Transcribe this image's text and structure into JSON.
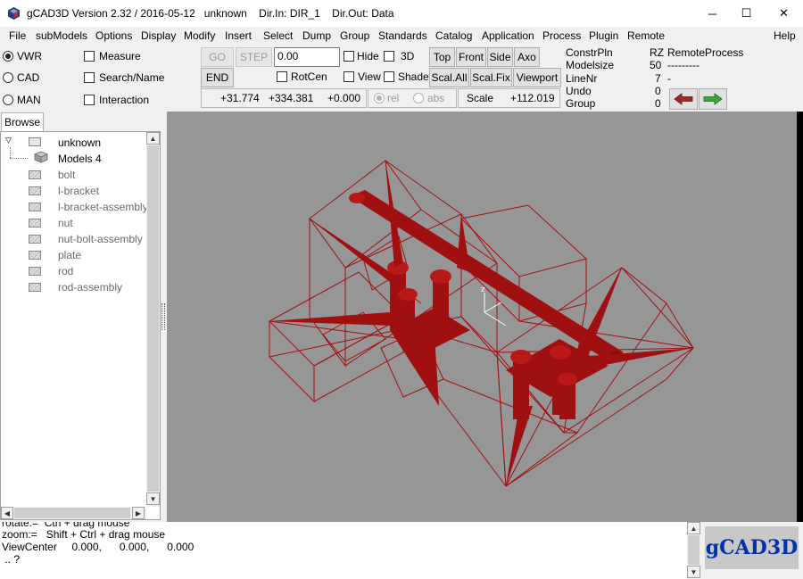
{
  "window": {
    "title": "gCAD3D Version 2.32 / 2016-05-12   unknown    Dir.In: DIR_1    Dir.Out: Data",
    "controls": {
      "minimize": "─",
      "maximize": "☐",
      "close": "✕"
    }
  },
  "menu": [
    "File",
    "subModels",
    "Options",
    "Display",
    "Modify",
    "Insert",
    "Select",
    "Dump",
    "Group",
    "Standards",
    "Catalog",
    "Application",
    "Process",
    "Plugin",
    "Remote",
    "Help"
  ],
  "modes": {
    "vwr": "VWR",
    "cad": "CAD",
    "man": "MAN",
    "selected": "VWR"
  },
  "options": {
    "measure": "Measure",
    "search": "Search/Name",
    "interaction": "Interaction"
  },
  "toolbar": {
    "go": "GO",
    "step": "STEP",
    "step_value": "0.00",
    "end": "END",
    "hide": "Hide",
    "three_d": "3D",
    "rotcen": "RotCen",
    "view": "View",
    "shade": "Shade",
    "top": "Top",
    "front": "Front",
    "side": "Side",
    "axo": "Axo",
    "scal_all": "Scal.All",
    "scal_fix": "Scal.Fix",
    "viewport": "Viewport"
  },
  "coords": {
    "x": "+31.774",
    "y": "+334.381",
    "z": "+0.000",
    "rel": "rel",
    "abs": "abs",
    "scale_label": "Scale",
    "scale_value": "+112.019"
  },
  "status": {
    "labels": [
      "ConstrPln",
      "Modelsize",
      "LineNr",
      "Undo",
      "Group"
    ],
    "values": [
      "RZ",
      "50",
      "7",
      "0",
      "0"
    ],
    "remote": "RemoteProcess",
    "remote_line": "---------",
    "remote_dash": "-"
  },
  "browse": {
    "tab": "Browse",
    "root": "unknown",
    "models_label": "Models 4",
    "items": [
      "bolt",
      "l-bracket",
      "l-bracket-assembly",
      "nut",
      "nut-bolt-assembly",
      "plate",
      "rod",
      "rod-assembly"
    ]
  },
  "console": {
    "lines": [
      "rotate:=  Ctrl + drag mouse",
      "zoom:=   Shift + Ctrl + drag mouse",
      "ViewCenter     0.000,      0.000,      0.000",
      " .. ?"
    ]
  },
  "logo": "gCAD3D",
  "colors": {
    "model": "#a01010",
    "viewport_bg": "#969696",
    "logo_text": "#0033aa"
  }
}
